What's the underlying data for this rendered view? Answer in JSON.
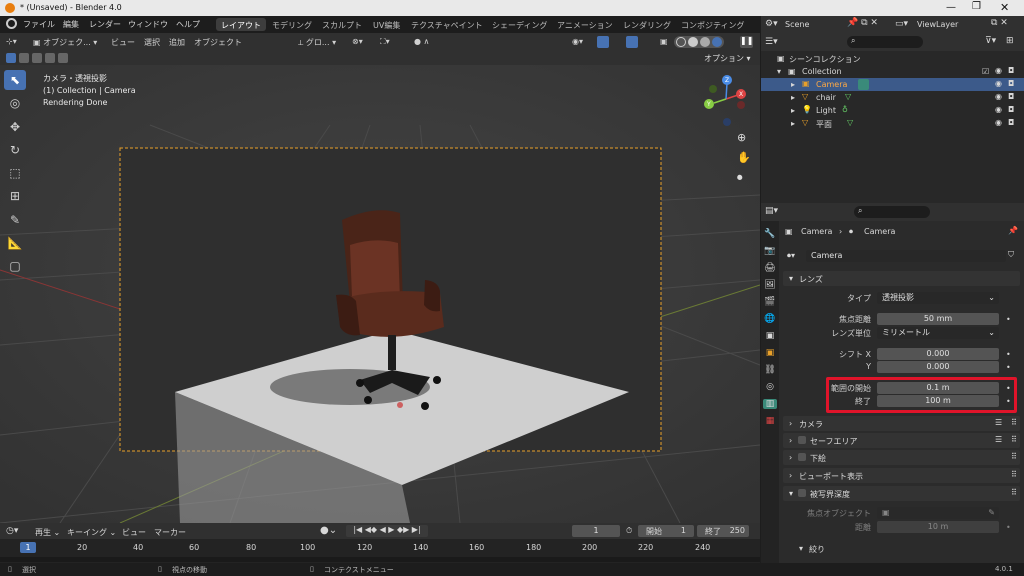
{
  "window": {
    "title": "* (Unsaved) - Blender 4.0"
  },
  "menu": [
    "ファイル",
    "編集",
    "レンダー",
    "ウィンドウ",
    "ヘルプ"
  ],
  "workspaces": [
    "レイアウト",
    "モデリング",
    "スカルプト",
    "UV編集",
    "テクスチャペイント",
    "シェーディング",
    "アニメーション",
    "レンダリング",
    "コンポジティング"
  ],
  "scene": {
    "name": "Scene",
    "view_layer": "ViewLayer"
  },
  "viewport_header": {
    "mode": "オブジェク...",
    "view": "ビュー",
    "select": "選択",
    "add": "追加",
    "object": "オブジェクト",
    "orientation": "グロ...",
    "options": "オプション"
  },
  "viewport_info": {
    "line1": "カメラ・透視投影",
    "line2": "(1) Collection | Camera",
    "line3": "Rendering Done"
  },
  "outliner": {
    "scene_collection": "シーンコレクション",
    "collection": "Collection",
    "items": [
      "Camera",
      "chair",
      "Light",
      "平面"
    ]
  },
  "properties": {
    "breadcrumb_obj": "Camera",
    "breadcrumb_data": "Camera",
    "datablock": "Camera",
    "lens_panel": "レンズ",
    "type_label": "タイプ",
    "type_value": "透視投影",
    "focal_label": "焦点距離",
    "focal_value": "50 mm",
    "lens_unit_label": "レンズ単位",
    "lens_unit_value": "ミリメートル",
    "shift_x_label": "シフト X",
    "shift_x_value": "0.000",
    "shift_y_label": "Y",
    "shift_y_value": "0.000",
    "clip_start_label": "範囲の開始",
    "clip_start_value": "0.1 m",
    "clip_end_label": "終了",
    "clip_end_value": "100 m",
    "camera_panel": "カメラ",
    "safe_areas_panel": "セーフエリア",
    "background_panel": "下絵",
    "viewport_display_panel": "ビューポート表示",
    "dof_panel": "被写界深度",
    "focus_object_label": "焦点オブジェクト",
    "distance_label": "距離",
    "distance_value": "10 m",
    "aperture_panel": "絞り"
  },
  "timeline": {
    "playback": "再生",
    "keying": "キーイング",
    "view": "ビュー",
    "marker": "マーカー",
    "current_frame": "1",
    "start_label": "開始",
    "start": "1",
    "end_label": "終了",
    "end": "250",
    "ticks": [
      "1",
      "20",
      "40",
      "60",
      "80",
      "100",
      "120",
      "140",
      "160",
      "180",
      "200",
      "220",
      "240"
    ]
  },
  "status": {
    "select": "選択",
    "rotate": "視点の移動",
    "context": "コンテクストメニュー",
    "version": "4.0.1"
  },
  "colors": {
    "accent": "#4772b3",
    "highlight": "#e0142a",
    "frame": "#e8a02a"
  }
}
